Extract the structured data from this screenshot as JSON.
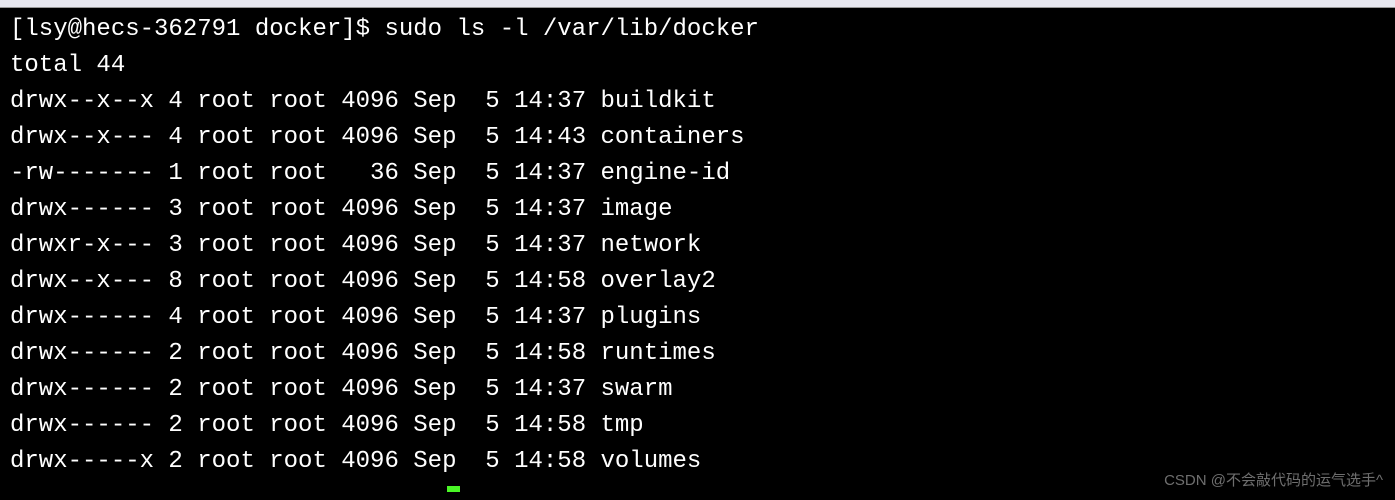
{
  "prompt": "[lsy@hecs-362791 docker]$ ",
  "command": "sudo ls -l /var/lib/docker",
  "total_line": "total 44",
  "entries": [
    {
      "perms": "drwx--x--x",
      "links": "4",
      "owner": "root",
      "group": "root",
      "size": "4096",
      "month": "Sep",
      "day": " 5",
      "time": "14:37",
      "name": "buildkit"
    },
    {
      "perms": "drwx--x---",
      "links": "4",
      "owner": "root",
      "group": "root",
      "size": "4096",
      "month": "Sep",
      "day": " 5",
      "time": "14:43",
      "name": "containers"
    },
    {
      "perms": "-rw-------",
      "links": "1",
      "owner": "root",
      "group": "root",
      "size": "  36",
      "month": "Sep",
      "day": " 5",
      "time": "14:37",
      "name": "engine-id"
    },
    {
      "perms": "drwx------",
      "links": "3",
      "owner": "root",
      "group": "root",
      "size": "4096",
      "month": "Sep",
      "day": " 5",
      "time": "14:37",
      "name": "image"
    },
    {
      "perms": "drwxr-x---",
      "links": "3",
      "owner": "root",
      "group": "root",
      "size": "4096",
      "month": "Sep",
      "day": " 5",
      "time": "14:37",
      "name": "network"
    },
    {
      "perms": "drwx--x---",
      "links": "8",
      "owner": "root",
      "group": "root",
      "size": "4096",
      "month": "Sep",
      "day": " 5",
      "time": "14:58",
      "name": "overlay2"
    },
    {
      "perms": "drwx------",
      "links": "4",
      "owner": "root",
      "group": "root",
      "size": "4096",
      "month": "Sep",
      "day": " 5",
      "time": "14:37",
      "name": "plugins"
    },
    {
      "perms": "drwx------",
      "links": "2",
      "owner": "root",
      "group": "root",
      "size": "4096",
      "month": "Sep",
      "day": " 5",
      "time": "14:58",
      "name": "runtimes"
    },
    {
      "perms": "drwx------",
      "links": "2",
      "owner": "root",
      "group": "root",
      "size": "4096",
      "month": "Sep",
      "day": " 5",
      "time": "14:37",
      "name": "swarm"
    },
    {
      "perms": "drwx------",
      "links": "2",
      "owner": "root",
      "group": "root",
      "size": "4096",
      "month": "Sep",
      "day": " 5",
      "time": "14:58",
      "name": "tmp"
    },
    {
      "perms": "drwx-----x",
      "links": "2",
      "owner": "root",
      "group": "root",
      "size": "4096",
      "month": "Sep",
      "day": " 5",
      "time": "14:58",
      "name": "volumes"
    }
  ],
  "watermark": "CSDN @不会敲代码的运气选手^"
}
